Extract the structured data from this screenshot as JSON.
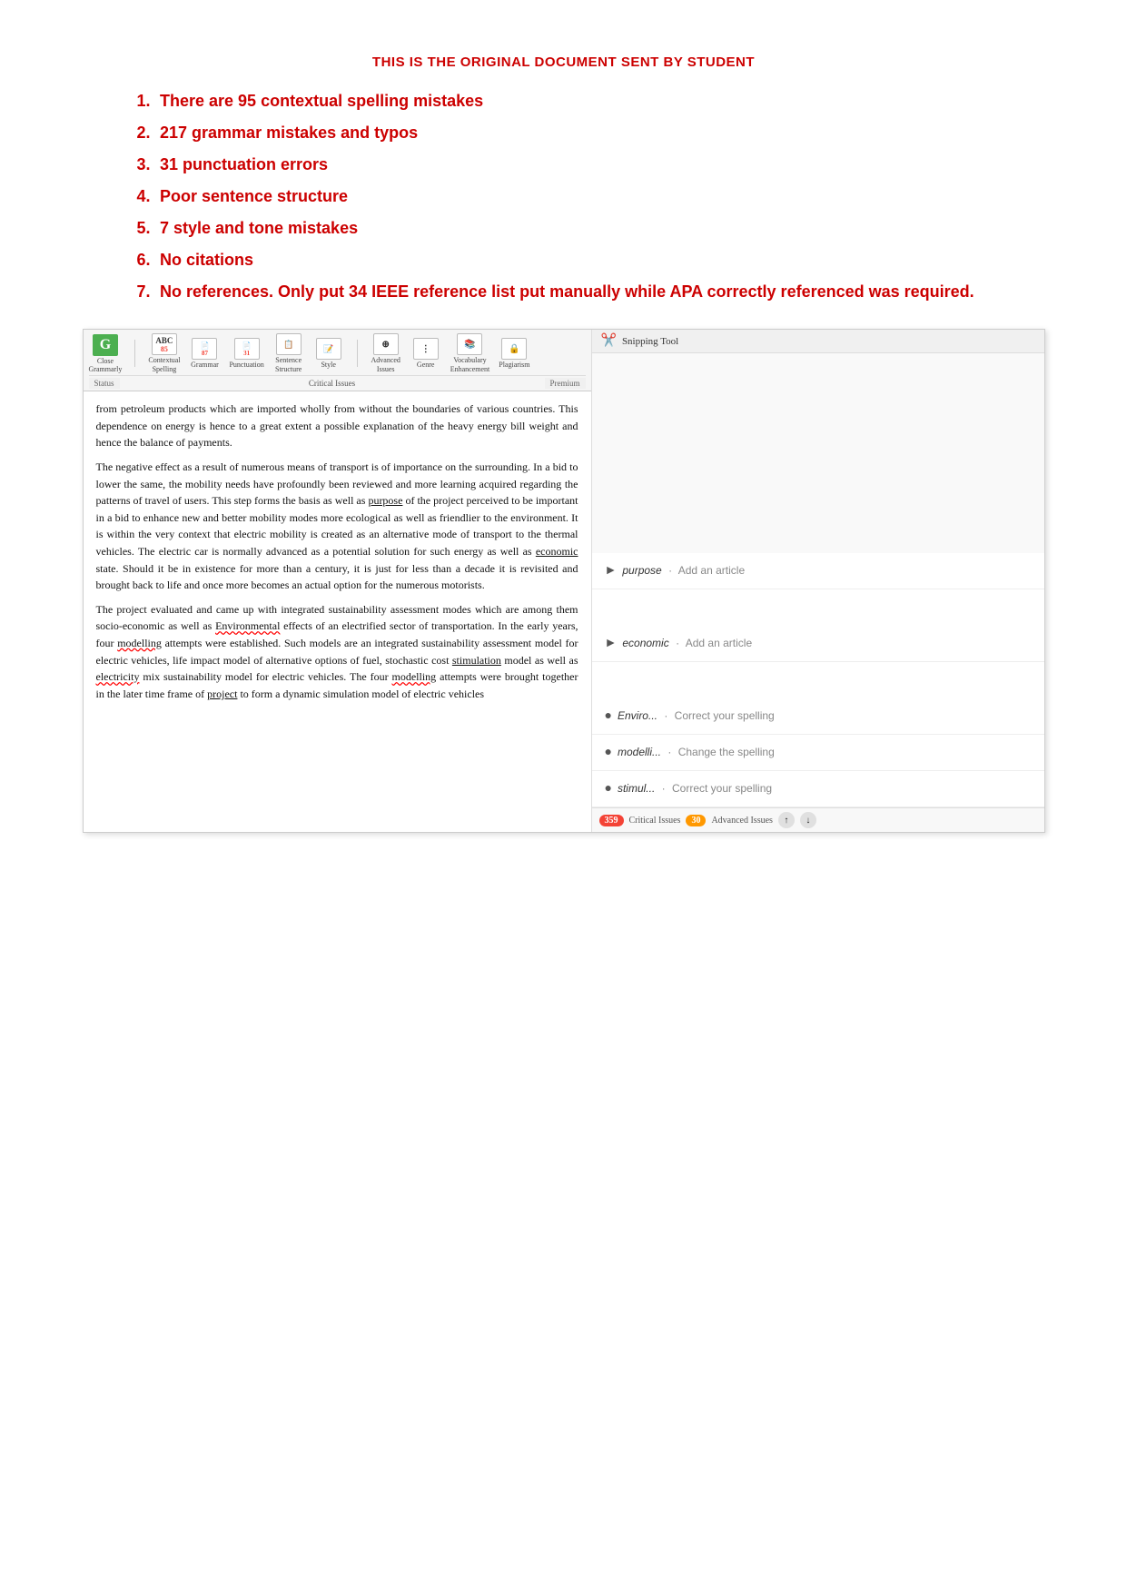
{
  "header": {
    "title": "THIS IS THE ORIGINAL DOCUMENT SENT BY STUDENT"
  },
  "issues": [
    {
      "num": "1.",
      "text": "There are 95 contextual spelling mistakes"
    },
    {
      "num": "2.",
      "text": "217 grammar mistakes and typos"
    },
    {
      "num": "3.",
      "text": "31 punctuation errors"
    },
    {
      "num": "4.",
      "text": "Poor sentence structure"
    },
    {
      "num": "5.",
      "text": "7 style and tone mistakes"
    },
    {
      "num": "6.",
      "text": "No citations"
    },
    {
      "num": "7.",
      "text": "No references. Only put 34 IEEE reference list put manually while APA correctly referenced was required."
    }
  ],
  "toolbar": {
    "close_label": "Close\nGrammarly",
    "contextual_label": "Contextual\nSpelling",
    "grammar_label": "Grammar",
    "punctuation_label": "Punctuation",
    "sentence_label": "Sentence\nStructure",
    "style_label": "Style",
    "advanced_label": "Advanced\nIssues",
    "genre_label": "Genre",
    "vocabulary_label": "Vocabulary\nEnhancement",
    "plagiarism_label": "Plagiarism",
    "status_label": "Status",
    "critical_issues_label": "Critical Issues",
    "premium_label": "Premium",
    "badge_85": "85",
    "badge_87": "87",
    "badge_31": "31"
  },
  "doc_text": {
    "para1": "from petroleum products which are imported wholly from without the boundaries of various countries. This dependence on energy is hence to a great extent a possible explanation of the heavy energy bill weight and hence the balance of payments.",
    "para2": "The negative effect as a result of numerous means of transport is of importance on the surrounding. In a bid to lower the same, the mobility needs have profoundly been reviewed and more learning acquired regarding the patterns of travel of users. This step forms the basis as well as purpose of the project perceived to be important in a bid to enhance new and better mobility modes more ecological as well as friendlier to the environment. It is within the very context that electric mobility is created as an alternative mode of transport to the thermal vehicles. The electric car is normally advanced as a potential solution for such energy as well as economic state. Should it be in existence for more than a century, it is just for less than a decade it is revisited and brought back to life and once more becomes an actual option for the numerous motorists.",
    "para3": "The project evaluated and came up with integrated sustainability assessment modes which are among them socio-economic as well as Environmental effects of an electrified sector of transportation. In the early years, four modelling attempts were established. Such models are an integrated sustainability assessment model for electric vehicles, life impact model of alternative options of fuel, stochastic cost stimulation model as well as electricity mix sustainability model for electric vehicles. The four modelling attempts were brought together in the later time frame of project to form a dynamic simulation model of electric vehicles"
  },
  "snipping_tool": {
    "label": "Snipping Tool"
  },
  "suggestions": [
    {
      "word": "purpose",
      "action": "Add an article"
    },
    {
      "word": "economic",
      "action": "Add an article"
    },
    {
      "word": "Enviro...",
      "action": "Correct your spelling"
    },
    {
      "word": "modelli...",
      "action": "Change the spelling"
    },
    {
      "word": "stimul...",
      "action": "Correct your spelling"
    }
  ],
  "bottom_bar": {
    "critical_count": "359",
    "advanced_count": "30",
    "critical_label": "Critical Issues",
    "advanced_label": "Advanced Issues"
  }
}
